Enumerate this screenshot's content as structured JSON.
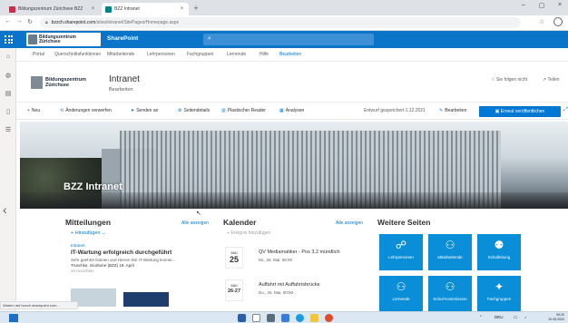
{
  "browser": {
    "tabs": [
      {
        "title": "Bildungszentrum Zürichsee BZZ",
        "favicon_color": "#c4314b"
      },
      {
        "title": "BZZ Intranet",
        "favicon_color": "#038387"
      }
    ],
    "new_tab": "+",
    "address": {
      "host": "bzzch.sharepoint.com",
      "path": "/sites/intranet/SitePages/Homepage.aspx"
    }
  },
  "suite": {
    "logo_text_1": "Bildungszentrum",
    "logo_text_2": "Zürichsee",
    "app_name": "SharePoint",
    "accent": "#0a74c9"
  },
  "hubnav": {
    "items": [
      "Portal",
      "Querschnittsfunktionen",
      "Mitarbeitende",
      "Lehrpersonen",
      "Fachgruppen",
      "Lernende",
      "Hilfe"
    ],
    "edit_label": "Bearbeiten"
  },
  "site": {
    "logo_text_1": "Bildungszentrum",
    "logo_text_2": "Zürichsee",
    "title": "Intranet",
    "subtitle": "Bearbeiten",
    "follow": "Sie folgen nicht",
    "share": "Teilen"
  },
  "commandbar": {
    "new": "Neu",
    "discard": "Änderungen verwerfen",
    "send": "Senden an",
    "page_details": "Seitendetails",
    "reader": "Plastischer Reader",
    "analytics": "Analysen",
    "saved": "Entwurf gespeichert 1.12.2021",
    "edit": "Bearbeiten",
    "publish": "Erneut veröffentlichen"
  },
  "hero": {
    "title": "BZZ Intranet"
  },
  "news": {
    "title": "Mitteilungen",
    "see_all": "Alle anzeigen",
    "add": "Hinzufügen",
    "item": {
      "tag": "Intranet",
      "headline": "IT-Wartung erfolgreich durchgeführt",
      "desc": "Sehr geehrte Damen und Herren Die IT-Wartung konnte...",
      "author": "Truschke, Giorbone (BZZ) 19. April",
      "views": "20 Ansichten"
    }
  },
  "calendar": {
    "title": "Kalender",
    "see_all": "Alle anzeigen",
    "add": "Ereignis hinzufügen",
    "events": [
      {
        "month": "MAI",
        "day": "25",
        "title": "QV Mediamatiker - Pos 3.2 mündlich",
        "time": "Mi., 25. Mai, 08:00"
      },
      {
        "month": "MAI",
        "day": "26-27",
        "title": "Auffahrt mit Auffahrtsbrücke",
        "time": "Do., 26. Mai, 00:00"
      }
    ]
  },
  "more_pages": {
    "title": "Weitere Seiten",
    "tile_color": "#0a8ed8",
    "tiles": [
      {
        "label": "Lehrpersonen",
        "icon": "☍"
      },
      {
        "label": "Mitarbeitende",
        "icon": "⚇"
      },
      {
        "label": "Schulleitung",
        "icon": "⚉"
      },
      {
        "label": "Lernende",
        "icon": "⚇"
      },
      {
        "label": "Schul-Kommission",
        "icon": "⚇"
      },
      {
        "label": "Fachgruppen",
        "icon": "✦"
      }
    ]
  },
  "status_url": "Warten auf bzzch.sharepoint.com...",
  "taskbar": {
    "lang": "DEU",
    "time": "09:20",
    "date": "20.05.2022"
  }
}
